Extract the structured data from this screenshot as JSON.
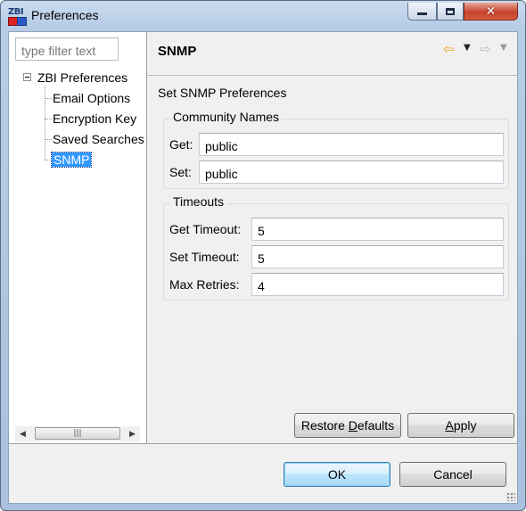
{
  "window": {
    "title": "Preferences",
    "app_icon_text": "ZBI",
    "close_glyph": "✕"
  },
  "sidebar": {
    "filter_placeholder": "type filter text",
    "root": {
      "label": "ZBI Preferences",
      "expanded": true
    },
    "items": [
      {
        "label": "Email Options",
        "selected": false
      },
      {
        "label": "Encryption Key",
        "selected": false
      },
      {
        "label": "Saved Searches",
        "selected": false
      },
      {
        "label": "SNMP",
        "selected": true
      }
    ],
    "scroll_thumb_glyph": "|||"
  },
  "page": {
    "title": "SNMP",
    "description": "Set SNMP Preferences",
    "nav_back_glyph": "⇦",
    "nav_forward_glyph": "⇨",
    "nav_menu_glyph": "▼"
  },
  "community": {
    "title": "Community Names",
    "get_label": "Get:",
    "get_value": "public",
    "set_label": "Set:",
    "set_value": "public"
  },
  "timeouts": {
    "title": "Timeouts",
    "get_timeout_label": "Get Timeout:",
    "get_timeout_value": "5",
    "set_timeout_label": "Set Timeout:",
    "set_timeout_value": "5",
    "max_retries_label": "Max Retries:",
    "max_retries_value": "4"
  },
  "buttons": {
    "restore_defaults": {
      "before": "Restore ",
      "mnemonic": "D",
      "after": "efaults"
    },
    "apply": {
      "before": "",
      "mnemonic": "A",
      "after": "pply"
    },
    "ok": "OK",
    "cancel": "Cancel"
  },
  "colors": {
    "selection": "#3399ff",
    "window_frame": "#b7cde6",
    "close_button": "#c6432b",
    "back_arrow": "#e6a716"
  }
}
